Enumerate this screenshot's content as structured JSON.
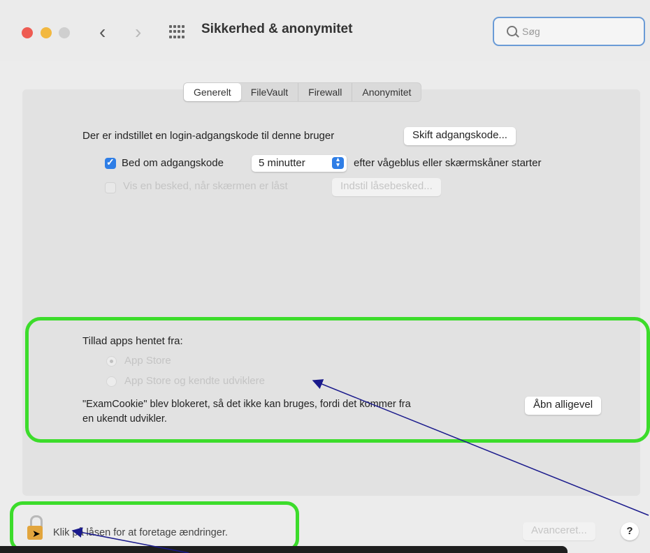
{
  "window": {
    "title": "Sikkerhed & anonymitet",
    "search_placeholder": "Søg"
  },
  "tabs": [
    {
      "label": "Generelt",
      "active": true
    },
    {
      "label": "FileVault",
      "active": false
    },
    {
      "label": "Firewall",
      "active": false
    },
    {
      "label": "Anonymitet",
      "active": false
    }
  ],
  "general": {
    "login_text": "Der er indstillet en login-adgangskode til denne bruger",
    "change_password_button": "Skift adgangskode...",
    "require_password_label": "Bed om adgangskode",
    "require_password_checked": true,
    "require_password_delay": "5 minutter",
    "require_password_suffix": "efter vågeblus eller skærmskåner starter",
    "show_message_label": "Vis en besked, når skærmen er låst",
    "show_message_checked": false,
    "set_lock_message_button": "Indstil låsebesked..."
  },
  "allow_apps": {
    "heading": "Tillad apps hentet fra:",
    "options": [
      {
        "label": "App Store",
        "selected": true
      },
      {
        "label": "App Store og kendte udviklere",
        "selected": false
      }
    ],
    "blocked_message_line1": "\"ExamCookie\" blev blokeret, så det ikke kan bruges, fordi det kommer fra",
    "blocked_message_line2": "en ukendt udvikler.",
    "open_anyway_button": "Åbn alligevel"
  },
  "footer": {
    "lock_text": "Klik på låsen for at foretage ændringer.",
    "advanced_button": "Avanceret...",
    "help_button": "?"
  },
  "colors": {
    "highlight": "#3cdc2b",
    "annotation_arrow": "#1a1a8c",
    "accent": "#2f7ee6"
  }
}
